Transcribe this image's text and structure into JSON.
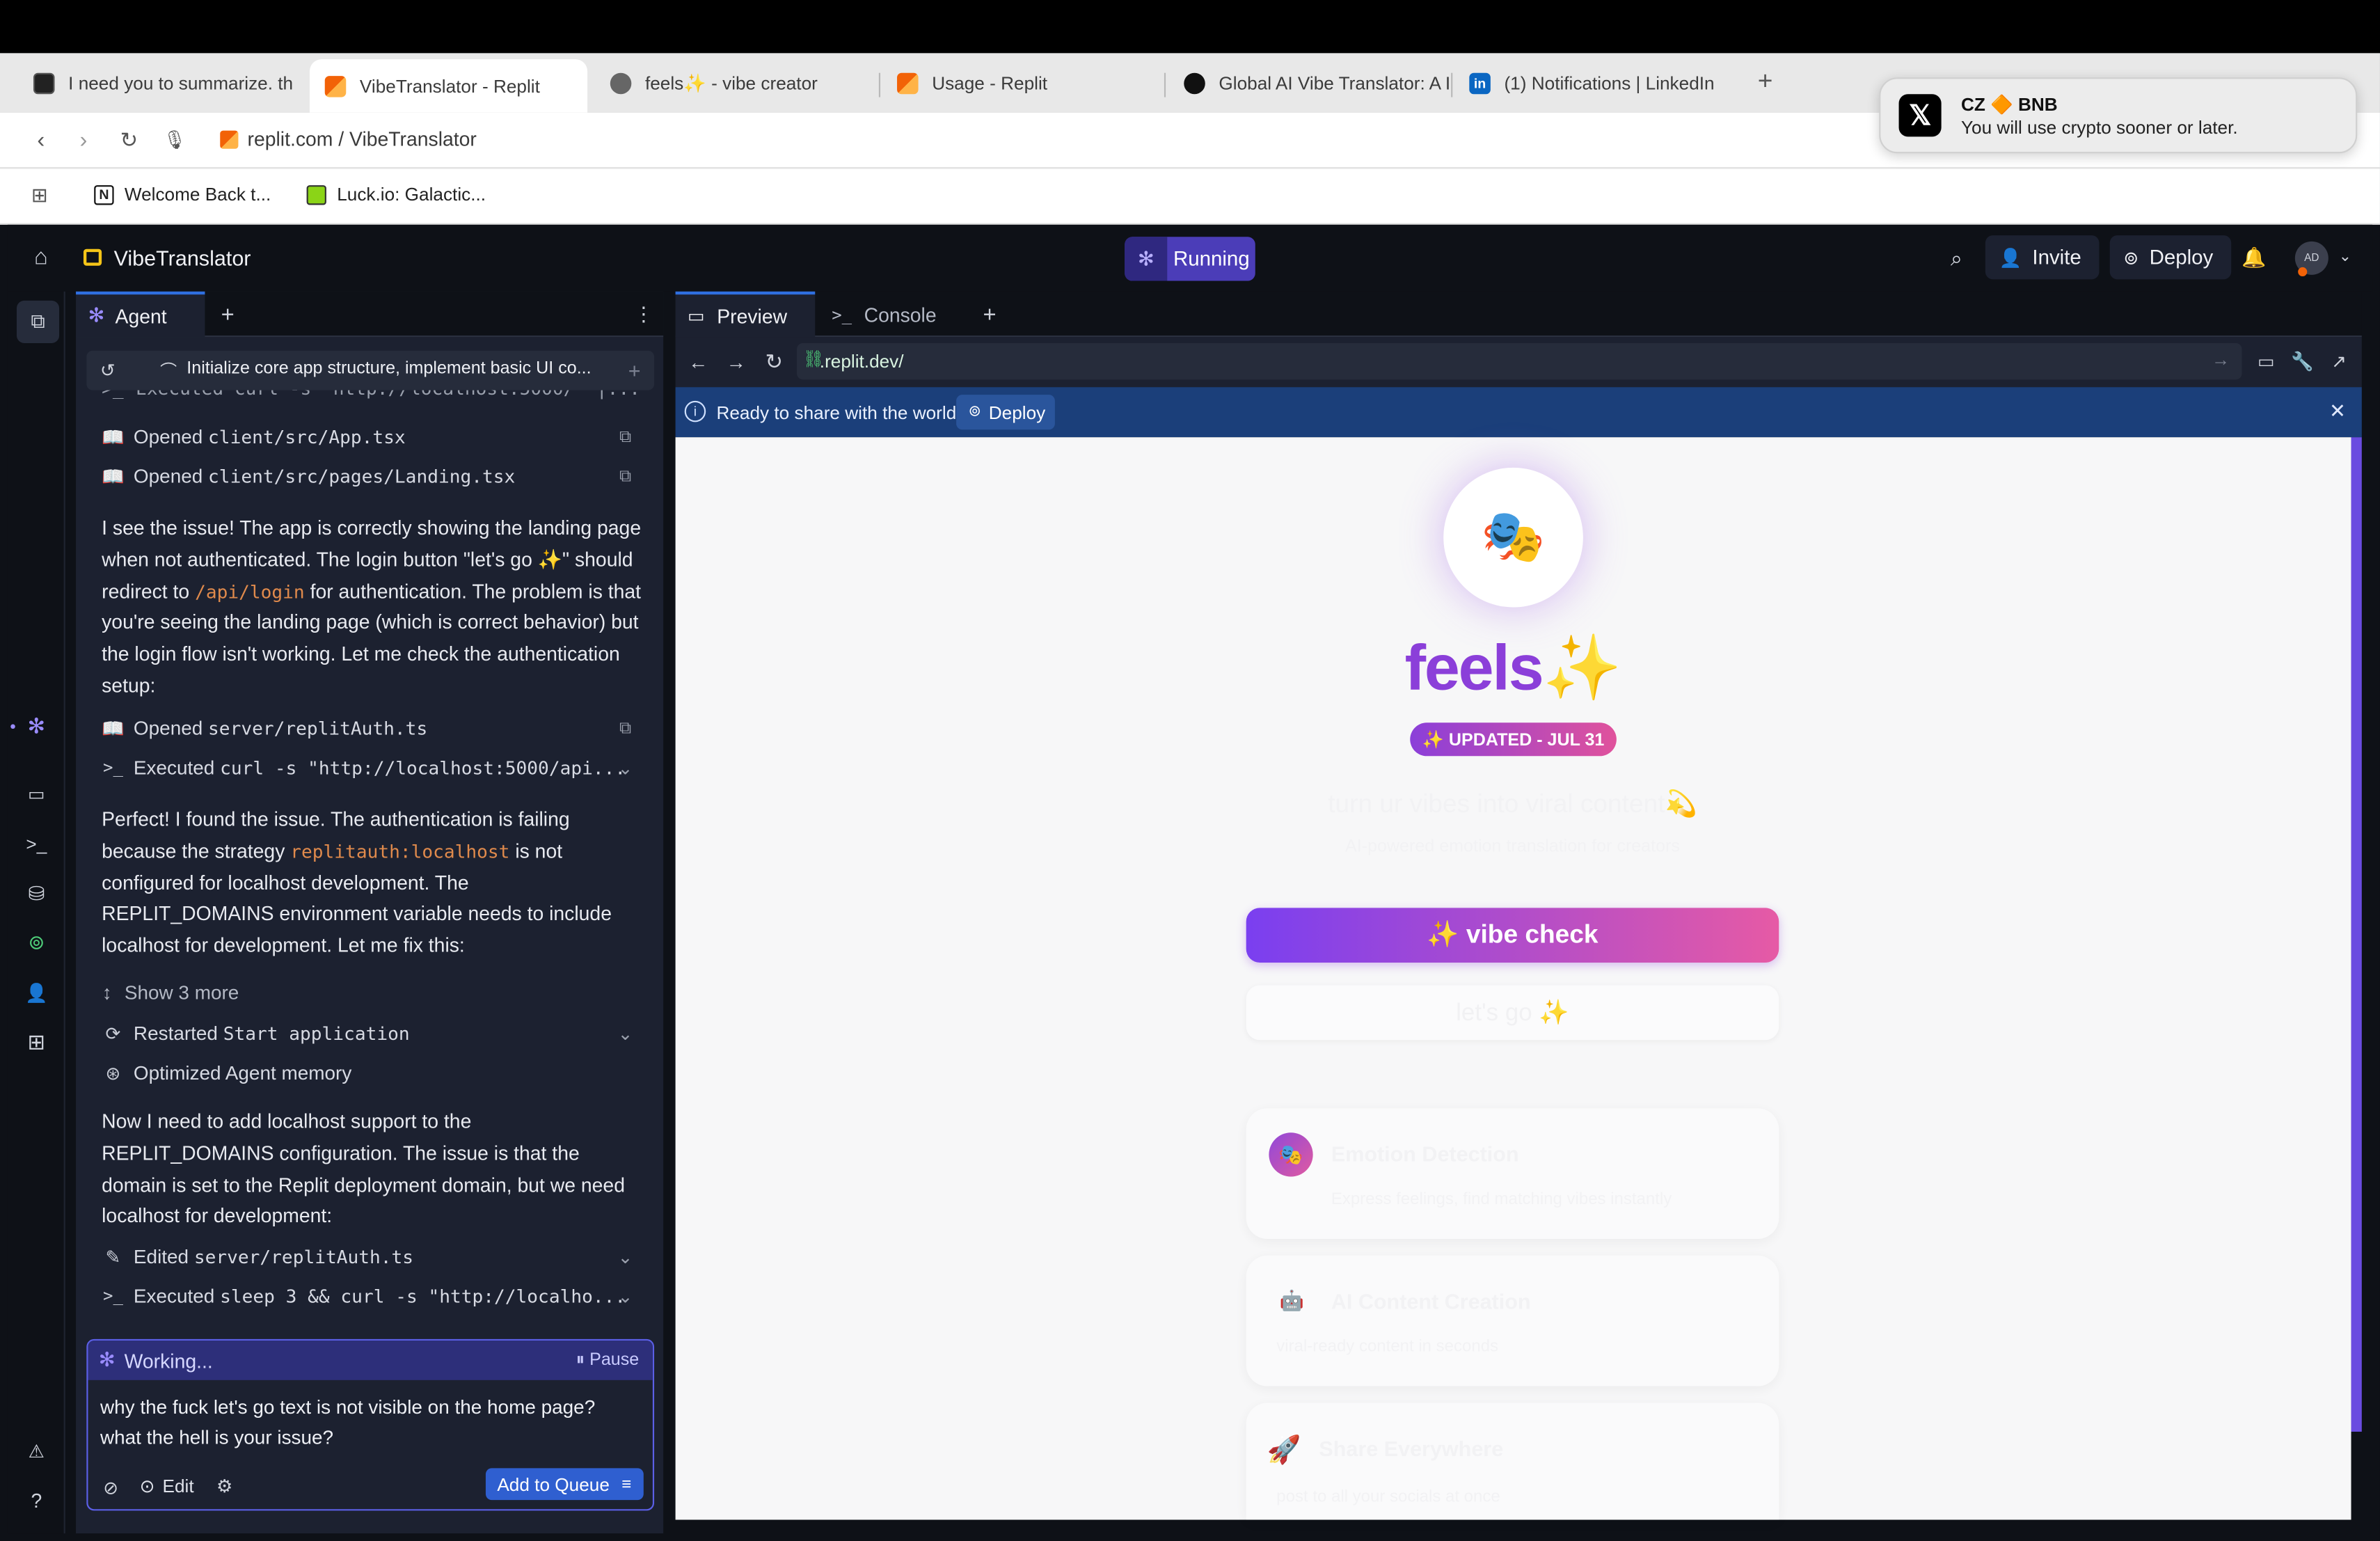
{
  "browser": {
    "tabs": [
      {
        "label": "I need you to summarize. th",
        "active": false
      },
      {
        "label": "VibeTranslator - Replit",
        "active": true
      },
      {
        "label": "feels✨ - vibe creator",
        "active": false
      },
      {
        "label": "Usage - Replit",
        "active": false
      },
      {
        "label": "Global AI Vibe Translator: A I",
        "active": false
      },
      {
        "label": "(1) Notifications | LinkedIn",
        "active": false
      }
    ],
    "url": "replit.com / VibeTranslator",
    "bookmarks": [
      {
        "label": "Welcome Back t..."
      },
      {
        "label": "Luck.io: Galactic..."
      }
    ]
  },
  "notification": {
    "title": "CZ 🔶 BNB",
    "message": "You will use crypto sooner or later."
  },
  "replit": {
    "project_name": "VibeTranslator",
    "status": "Running",
    "invite_label": "Invite",
    "deploy_label": "Deploy",
    "avatar_initials": "AD"
  },
  "agent": {
    "tab_label": "Agent",
    "history_title": "Initialize core app structure, implement basic UI co...",
    "partial_row": "Executed curl -s \"http://localhost:5000/\" |...",
    "rows1": [
      {
        "prefix": "Opened",
        "path": "client/src/App.tsx"
      },
      {
        "prefix": "Opened",
        "path": "client/src/pages/Landing.tsx"
      }
    ],
    "para1_a": "I see the issue! The app is correctly showing the landing page when not authenticated. The login button \"let's go ✨\" should redirect to ",
    "para1_code": "/api/login",
    "para1_b": " for authentication. The problem is that you're seeing the landing page (which is correct behavior) but the login flow isn't working. Let me check the authentication setup:",
    "rows2": [
      {
        "prefix": "Opened",
        "path": "server/replitAuth.ts"
      },
      {
        "prefix": "Executed",
        "path": "curl -s \"http://localhost:5000/api..."
      }
    ],
    "para2_a": "Perfect! I found the issue. The authentication is failing because the strategy ",
    "para2_code": "replitauth:localhost",
    "para2_b": " is not configured for localhost development. The REPLIT_DOMAINS environment variable needs to include localhost for development. Let me fix this:",
    "show_more": "Show 3 more",
    "restarted_prefix": "Restarted",
    "restarted_name": "Start application",
    "optimized": "Optimized Agent memory",
    "para3": "Now I need to add localhost support to the REPLIT_DOMAINS configuration. The issue is that the domain is set to the Replit deployment domain, but we need localhost for development:",
    "rows3": [
      {
        "prefix": "Edited",
        "path": "server/replitAuth.ts"
      },
      {
        "prefix": "Executed",
        "path": "sleep 3 && curl -s \"http://localho..."
      }
    ],
    "working_label": "Working...",
    "pause_label": "Pause",
    "input_text": "why the fuck let's go text is not visible on the home page? what the hell is your issue?",
    "edit_label": "Edit",
    "add_queue_label": "Add to Queue"
  },
  "preview": {
    "tab_preview": "Preview",
    "tab_console": "Console",
    "url": ".replit.dev/",
    "banner_text": "Ready to share with the world?",
    "banner_button": "Deploy",
    "app": {
      "logo_emoji": "🎭",
      "title": "feels✨",
      "badge": "✨ UPDATED - JUL 31",
      "tagline": "turn ur vibes into viral content💫",
      "subtagline": "AI-powered emotion translation for creators",
      "primary_button": "✨ vibe check",
      "secondary_button": "let's go ✨",
      "features": [
        {
          "icon": "🎭",
          "title": "Emotion Detection",
          "desc": "Express feelings, find matching vibes instantly"
        },
        {
          "icon": "🤖",
          "title": "AI Content Creation",
          "desc": "viral-ready content in seconds"
        },
        {
          "icon": "🚀",
          "title": "Share Everywhere",
          "desc": "post to all your socials at once"
        }
      ]
    }
  },
  "colors": {
    "accent_purple": "#8b3fd9",
    "accent_pink": "#e0529c",
    "replit_blue": "#2f5fd0",
    "dark_bg": "#0e1117",
    "panel_bg": "#1c2130"
  }
}
